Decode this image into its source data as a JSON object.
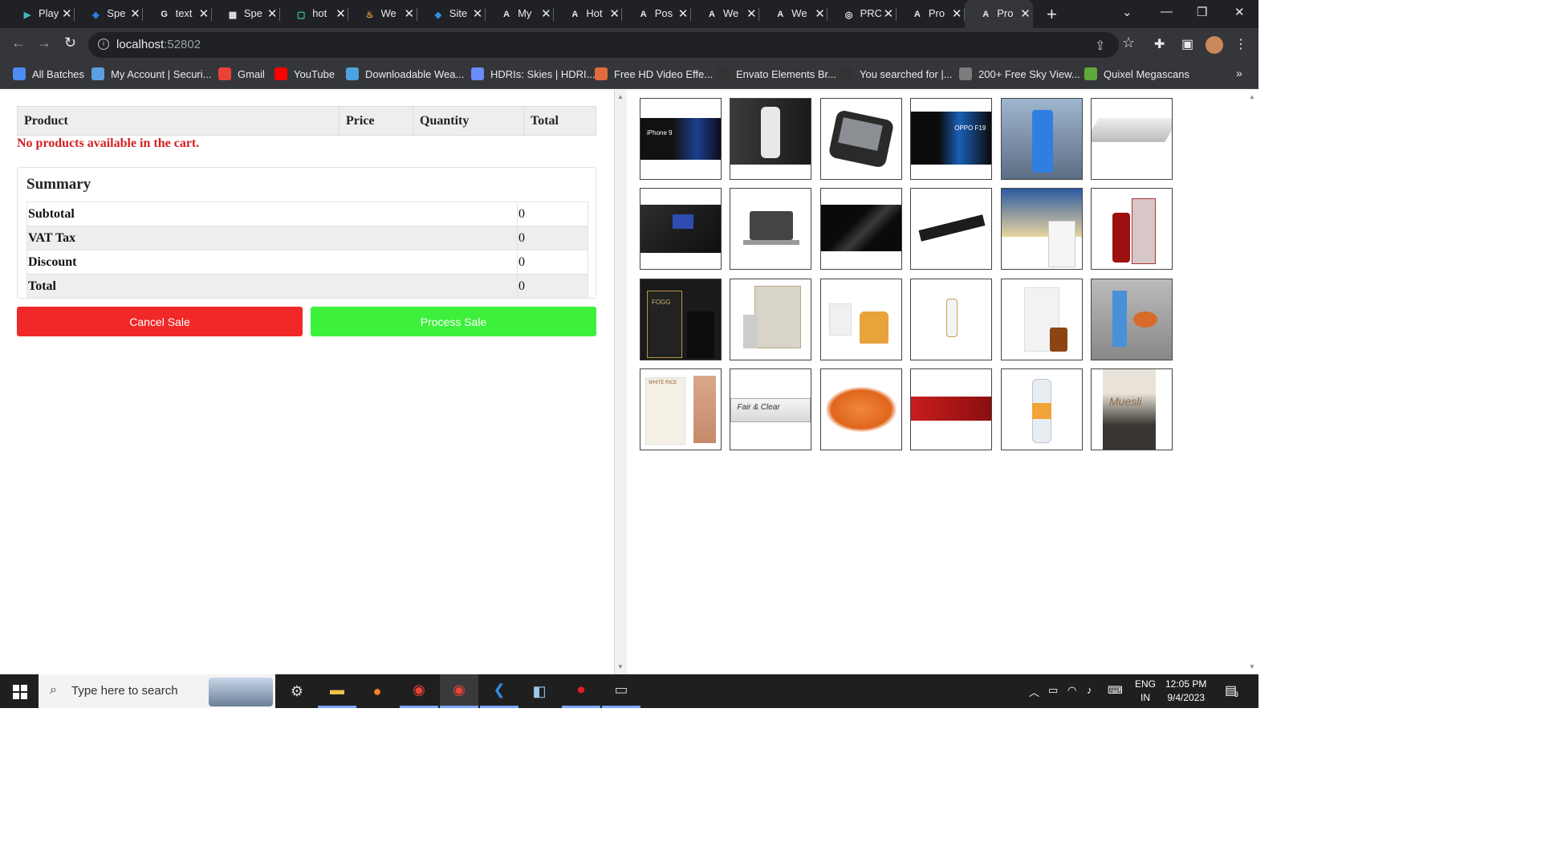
{
  "browser": {
    "tabs": [
      {
        "title": "Play",
        "icon": "play-icon"
      },
      {
        "title": "Spe",
        "icon": "speed-icon"
      },
      {
        "title": "text",
        "icon": "google-icon"
      },
      {
        "title": "Spe",
        "icon": "store-icon"
      },
      {
        "title": "hot",
        "icon": "frame-icon"
      },
      {
        "title": "We",
        "icon": "flame-icon"
      },
      {
        "title": "Site",
        "icon": "diamond-icon"
      },
      {
        "title": "My",
        "icon": "a-icon"
      },
      {
        "title": "Hot",
        "icon": "a-icon"
      },
      {
        "title": "Pos",
        "icon": "a-icon"
      },
      {
        "title": "We",
        "icon": "a-icon"
      },
      {
        "title": "We",
        "icon": "a-icon"
      },
      {
        "title": "PRC",
        "icon": "camera-icon"
      },
      {
        "title": "Pro",
        "icon": "a-icon"
      },
      {
        "title": "Pro",
        "icon": "a-icon",
        "active": true
      }
    ],
    "url_host": "localhost",
    "url_port": ":52802",
    "bookmarks": [
      {
        "label": "All Batches",
        "color": "#4d8cf5"
      },
      {
        "label": "My Account | Securi...",
        "color": "#5aa0e0"
      },
      {
        "label": "Gmail",
        "color": "#ea4335"
      },
      {
        "label": "YouTube",
        "color": "#ff0000"
      },
      {
        "label": "Downloadable Wea...",
        "color": "#4aa3df"
      },
      {
        "label": "HDRIs: Skies | HDRI...",
        "color": "#6b8cff"
      },
      {
        "label": "Free HD Video Effe...",
        "color": "#e06b3c"
      },
      {
        "label": "Envato Elements Br...",
        "color": "#333333"
      },
      {
        "label": "You searched for |...",
        "color": "#333333"
      },
      {
        "label": "200+ Free Sky View...",
        "color": "#7c7c7c"
      },
      {
        "label": "Quixel Megascans",
        "color": "#5fa83a"
      }
    ]
  },
  "cart": {
    "columns": [
      "Product",
      "Price",
      "Quantity",
      "Total"
    ],
    "empty_message": "No products available in the cart."
  },
  "summary": {
    "title": "Summary",
    "rows": [
      {
        "label": "Subtotal",
        "value": "0"
      },
      {
        "label": "VAT Tax",
        "value": "0"
      },
      {
        "label": "Discount",
        "value": "0"
      },
      {
        "label": "Total",
        "value": "0"
      }
    ]
  },
  "actions": {
    "cancel_label": "Cancel Sale",
    "process_label": "Process Sale",
    "cancel_color": "#f02828",
    "process_color": "#3cf03c"
  },
  "products": [
    {
      "name": "iphone-9",
      "caption": "iPhone 9"
    },
    {
      "name": "iphone-x"
    },
    {
      "name": "slider-phone"
    },
    {
      "name": "oppo-f19",
      "caption": "OPPO F19"
    },
    {
      "name": "huawei-phone"
    },
    {
      "name": "silver-laptop"
    },
    {
      "name": "black-laptop"
    },
    {
      "name": "surface-laptop"
    },
    {
      "name": "infinix-inbook"
    },
    {
      "name": "thin-laptop"
    },
    {
      "name": "perfume-bottle"
    },
    {
      "name": "red-perfume"
    },
    {
      "name": "fogg-perfume",
      "caption": "FOGG"
    },
    {
      "name": "attar-box"
    },
    {
      "name": "orange-perfume"
    },
    {
      "name": "serum-dropper"
    },
    {
      "name": "tree-oil"
    },
    {
      "name": "cream-tubes"
    },
    {
      "name": "white-rice-serum",
      "caption": "WHITE RICE"
    },
    {
      "name": "fair-clear-cream",
      "caption": "Fair & Clear"
    },
    {
      "name": "orange-granules"
    },
    {
      "name": "sweets-tray"
    },
    {
      "name": "bottle-drink"
    },
    {
      "name": "muesli-pack",
      "caption": "Muesli"
    }
  ],
  "taskbar": {
    "search_placeholder": "Type here to search",
    "lang_top": "ENG",
    "lang_bottom": "IN",
    "time": "12:05 PM",
    "date": "9/4/2023",
    "notifications": "3"
  }
}
